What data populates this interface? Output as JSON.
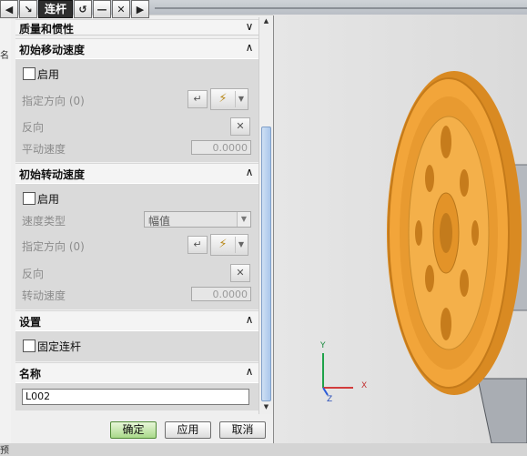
{
  "title": "连杆",
  "titlebar_buttons": [
    "back-icon",
    "select-arrow-icon",
    "undo-icon",
    "minimize-icon",
    "close-icon"
  ],
  "sections": {
    "mass_props": {
      "label": "质量和惯性"
    },
    "initial_translation": {
      "label": "初始移动速度",
      "enable_label": "启用",
      "direction_label": "指定方向 (0)",
      "reverse_label": "反向",
      "speed_label": "平动速度",
      "speed_value": "0.0000"
    },
    "initial_rotation": {
      "label": "初始转动速度",
      "enable_label": "启用",
      "speed_type_label": "速度类型",
      "speed_type_value": "幅值",
      "direction_label": "指定方向 (0)",
      "reverse_label": "反向",
      "speed_label": "转动速度",
      "speed_value": "0.0000"
    },
    "settings": {
      "label": "设置",
      "fixed_link_label": "固定连杆"
    },
    "name": {
      "label": "名称",
      "value": "L002"
    }
  },
  "buttons": {
    "ok": "确定",
    "apply": "应用",
    "cancel": "取消"
  },
  "triad": {
    "x": "X",
    "y": "Y",
    "z": "Z"
  },
  "edge_fragments": {
    "left_top": "名",
    "left_bottom": "预"
  },
  "colors": {
    "wheel": "#f2a53a",
    "dialog_bg": "#dadada",
    "ok_button": "#a9d98a"
  }
}
